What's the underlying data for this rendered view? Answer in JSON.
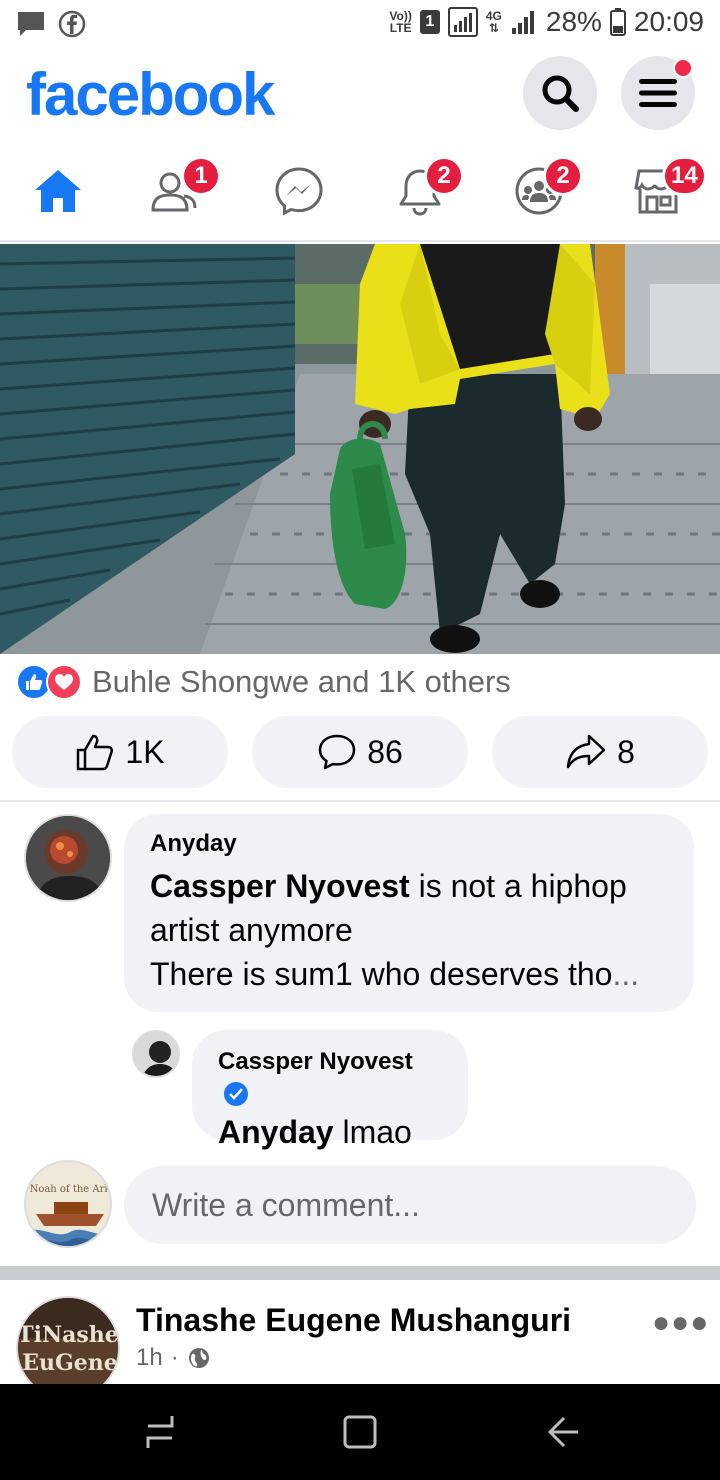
{
  "status_bar": {
    "network_label_top": "Vo))",
    "network_label_bottom": "LTE",
    "sim_number": "1",
    "data_type": "4G",
    "battery_percent": "28%",
    "time": "20:09"
  },
  "header": {
    "logo_text": "facebook",
    "accent_color": "#1877f2"
  },
  "nav": {
    "items": [
      {
        "name": "home",
        "icon": "home-icon",
        "badge": ""
      },
      {
        "name": "friends",
        "icon": "friends-icon",
        "badge": "1"
      },
      {
        "name": "messenger",
        "icon": "messenger-icon",
        "badge": ""
      },
      {
        "name": "notifications",
        "icon": "bell-icon",
        "badge": "2"
      },
      {
        "name": "groups",
        "icon": "groups-icon",
        "badge": "2"
      },
      {
        "name": "marketplace",
        "icon": "marketplace-icon",
        "badge": "14"
      }
    ]
  },
  "post": {
    "reactions_text": "Buhle Shongwe and 1K others",
    "like_count": "1K",
    "comment_count": "86",
    "share_count": "8"
  },
  "comments": [
    {
      "author": "Anyday",
      "mention": "Cassper Nyovest",
      "text_rest": " is not a hiphop artist anymore",
      "text_line2": "There is sum1 who deserves tho",
      "ellipsis": "..."
    }
  ],
  "reply": {
    "author": "Cassper Nyovest",
    "mention": "Anyday",
    "text": " lmao"
  },
  "composer": {
    "placeholder": "Write a comment",
    "placeholder_dots": "..."
  },
  "next_post": {
    "author": "Tinashe Eugene  Mushanguri",
    "time": "1h",
    "separator": "·",
    "avatar_text_top": "TiNashe",
    "avatar_text_bottom": "EuGene"
  },
  "composer_avatar": {
    "text": "Noah of the Ark"
  }
}
